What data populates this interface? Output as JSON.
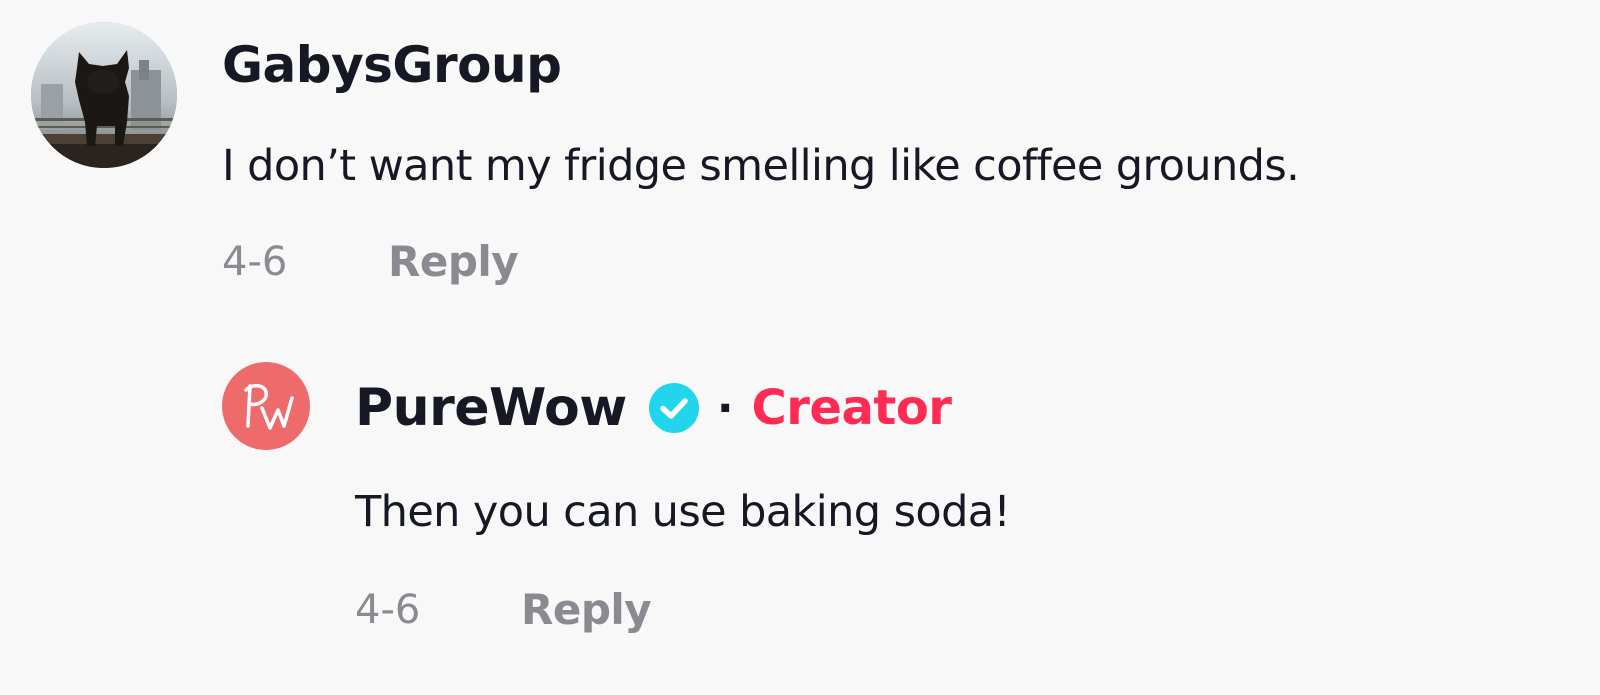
{
  "comment": {
    "username": "GabysGroup",
    "text": "I don’t want my fridge smelling like coffee grounds.",
    "date": "4-6",
    "reply_label": "Reply",
    "avatar_icon": "french-bulldog-photo"
  },
  "reply": {
    "username": "PureWow",
    "verified_icon": "verified-check-icon",
    "separator": "·",
    "role_label": "Creator",
    "text": "Then you can use baking soda!",
    "date": "4-6",
    "reply_label": "Reply",
    "avatar_icon": "purewow-logo"
  },
  "colors": {
    "background": "#f8f8f8",
    "text": "#161823",
    "muted": "#8a8b91",
    "creator": "#fe2c55",
    "verified": "#20d5ec",
    "avatar_pw": "#ee6b6c"
  }
}
